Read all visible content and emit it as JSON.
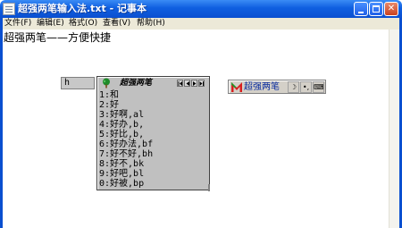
{
  "window": {
    "title": "超强两笔输入法.txt - 记事本"
  },
  "menu": {
    "items": [
      {
        "label": "文件(F)"
      },
      {
        "label": "编辑(E)"
      },
      {
        "label": "格式(O)"
      },
      {
        "label": "查看(V)"
      },
      {
        "label": "帮助(H)"
      }
    ]
  },
  "document": {
    "text": "超强两笔——方便快捷"
  },
  "ime": {
    "input_code": "h",
    "candidate_title": "超强两笔",
    "candidates": [
      "1:和",
      "2:好",
      "3:好啊,al",
      "4:好办,b,",
      "5:好比,b,",
      "6:好办法,bf",
      "7:好不好,bh",
      "8:好不,bk",
      "9:好吧,bl",
      "0:好被,bp"
    ],
    "status_name": "超强两笔",
    "status_moon": "☽",
    "status_punct": "•,",
    "status_keyboard": "⌨"
  },
  "colors": {
    "titlebar": "#0f5fe0",
    "menubar": "#ece9d8",
    "panel": "#c0c0c0",
    "ime_name": "#0a2da0"
  }
}
